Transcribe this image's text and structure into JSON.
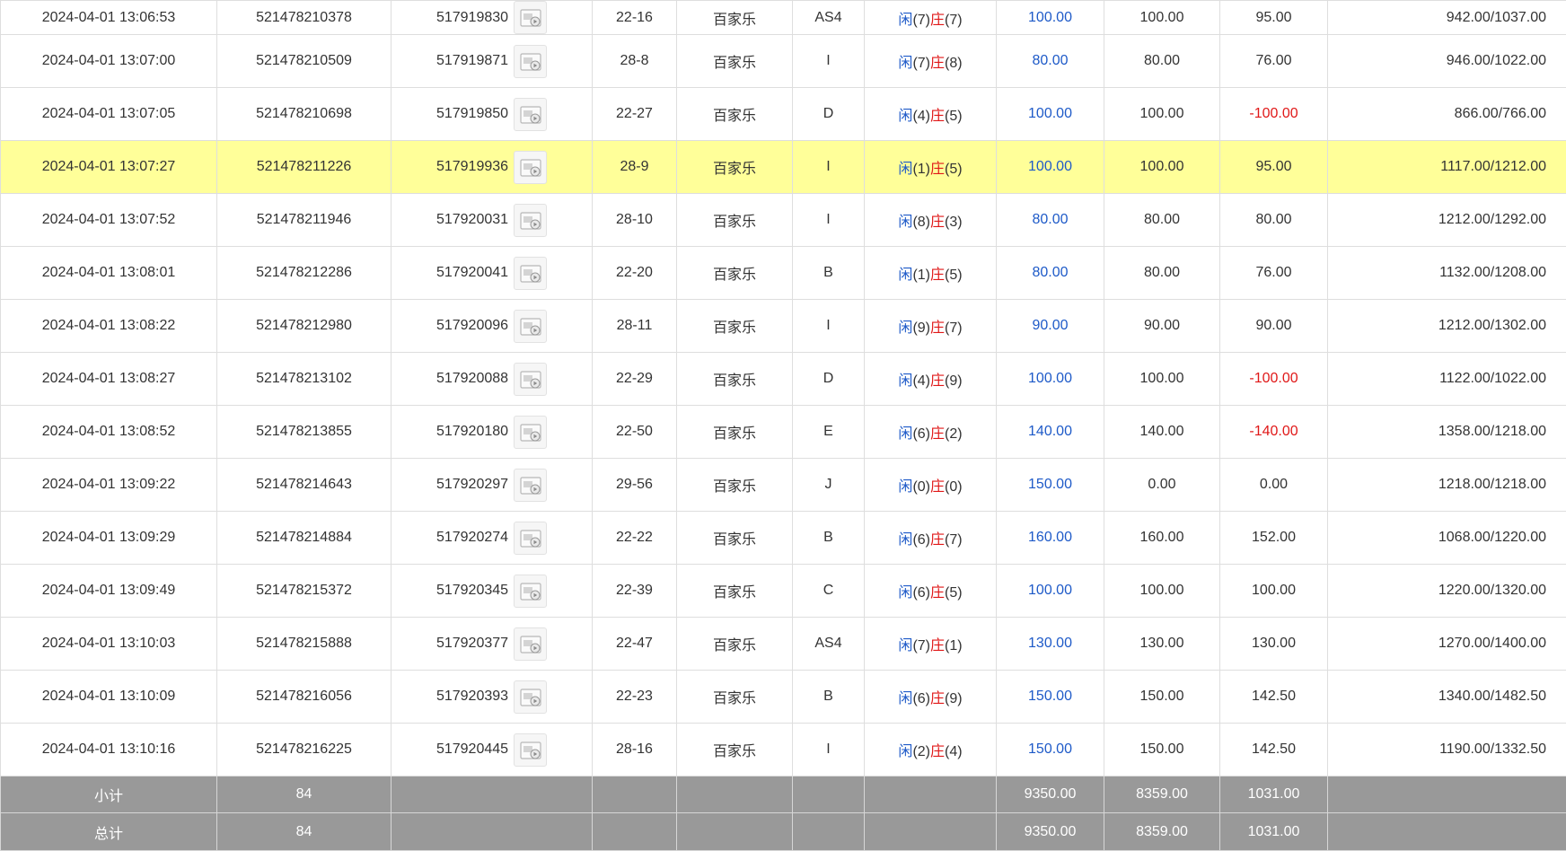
{
  "table": {
    "top_partial": {
      "bet_time": "2024-04-01 13:06:53",
      "bet_no": "521478210378",
      "game_no": "517919830",
      "table": "22-16",
      "game_type": "百家乐",
      "seat": "AS4",
      "player_score": "7",
      "banker_score": "7",
      "bet_amount": "100.00",
      "valid_bet": "100.00",
      "win_loss": "95.00",
      "balance": "942.00/1037.00"
    },
    "labels": {
      "player": "闲",
      "banker": "庄"
    },
    "rows": [
      {
        "bet_time": "2024-04-01 13:07:00",
        "bet_no": "521478210509",
        "game_no": "517919871",
        "table": "28-8",
        "game_type": "百家乐",
        "seat": "I",
        "player_score": "7",
        "banker_score": "8",
        "bet_amount": "80.00",
        "valid_bet": "80.00",
        "win_loss": "76.00",
        "balance": "946.00/1022.00"
      },
      {
        "bet_time": "2024-04-01 13:07:05",
        "bet_no": "521478210698",
        "game_no": "517919850",
        "table": "22-27",
        "game_type": "百家乐",
        "seat": "D",
        "player_score": "4",
        "banker_score": "5",
        "bet_amount": "100.00",
        "valid_bet": "100.00",
        "win_loss": "-100.00",
        "balance": "866.00/766.00"
      },
      {
        "bet_time": "2024-04-01 13:07:27",
        "bet_no": "521478211226",
        "game_no": "517919936",
        "table": "28-9",
        "game_type": "百家乐",
        "seat": "I",
        "player_score": "1",
        "banker_score": "5",
        "bet_amount": "100.00",
        "valid_bet": "100.00",
        "win_loss": "95.00",
        "balance": "1117.00/1212.00"
      },
      {
        "bet_time": "2024-04-01 13:07:52",
        "bet_no": "521478211946",
        "game_no": "517920031",
        "table": "28-10",
        "game_type": "百家乐",
        "seat": "I",
        "player_score": "8",
        "banker_score": "3",
        "bet_amount": "80.00",
        "valid_bet": "80.00",
        "win_loss": "80.00",
        "balance": "1212.00/1292.00"
      },
      {
        "bet_time": "2024-04-01 13:08:01",
        "bet_no": "521478212286",
        "game_no": "517920041",
        "table": "22-20",
        "game_type": "百家乐",
        "seat": "B",
        "player_score": "1",
        "banker_score": "5",
        "bet_amount": "80.00",
        "valid_bet": "80.00",
        "win_loss": "76.00",
        "balance": "1132.00/1208.00"
      },
      {
        "bet_time": "2024-04-01 13:08:22",
        "bet_no": "521478212980",
        "game_no": "517920096",
        "table": "28-11",
        "game_type": "百家乐",
        "seat": "I",
        "player_score": "9",
        "banker_score": "7",
        "bet_amount": "90.00",
        "valid_bet": "90.00",
        "win_loss": "90.00",
        "balance": "1212.00/1302.00"
      },
      {
        "bet_time": "2024-04-01 13:08:27",
        "bet_no": "521478213102",
        "game_no": "517920088",
        "table": "22-29",
        "game_type": "百家乐",
        "seat": "D",
        "player_score": "4",
        "banker_score": "9",
        "bet_amount": "100.00",
        "valid_bet": "100.00",
        "win_loss": "-100.00",
        "balance": "1122.00/1022.00"
      },
      {
        "bet_time": "2024-04-01 13:08:52",
        "bet_no": "521478213855",
        "game_no": "517920180",
        "table": "22-50",
        "game_type": "百家乐",
        "seat": "E",
        "player_score": "6",
        "banker_score": "2",
        "bet_amount": "140.00",
        "valid_bet": "140.00",
        "win_loss": "-140.00",
        "balance": "1358.00/1218.00"
      },
      {
        "bet_time": "2024-04-01 13:09:22",
        "bet_no": "521478214643",
        "game_no": "517920297",
        "table": "29-56",
        "game_type": "百家乐",
        "seat": "J",
        "player_score": "0",
        "banker_score": "0",
        "bet_amount": "150.00",
        "valid_bet": "0.00",
        "win_loss": "0.00",
        "balance": "1218.00/1218.00"
      },
      {
        "bet_time": "2024-04-01 13:09:29",
        "bet_no": "521478214884",
        "game_no": "517920274",
        "table": "22-22",
        "game_type": "百家乐",
        "seat": "B",
        "player_score": "6",
        "banker_score": "7",
        "bet_amount": "160.00",
        "valid_bet": "160.00",
        "win_loss": "152.00",
        "balance": "1068.00/1220.00"
      },
      {
        "bet_time": "2024-04-01 13:09:49",
        "bet_no": "521478215372",
        "game_no": "517920345",
        "table": "22-39",
        "game_type": "百家乐",
        "seat": "C",
        "player_score": "6",
        "banker_score": "5",
        "bet_amount": "100.00",
        "valid_bet": "100.00",
        "win_loss": "100.00",
        "balance": "1220.00/1320.00"
      },
      {
        "bet_time": "2024-04-01 13:10:03",
        "bet_no": "521478215888",
        "game_no": "517920377",
        "table": "22-47",
        "game_type": "百家乐",
        "seat": "AS4",
        "player_score": "7",
        "banker_score": "1",
        "bet_amount": "130.00",
        "valid_bet": "130.00",
        "win_loss": "130.00",
        "balance": "1270.00/1400.00"
      },
      {
        "bet_time": "2024-04-01 13:10:09",
        "bet_no": "521478216056",
        "game_no": "517920393",
        "table": "22-23",
        "game_type": "百家乐",
        "seat": "B",
        "player_score": "6",
        "banker_score": "9",
        "bet_amount": "150.00",
        "valid_bet": "150.00",
        "win_loss": "142.50",
        "balance": "1340.00/1482.50"
      },
      {
        "bet_time": "2024-04-01 13:10:16",
        "bet_no": "521478216225",
        "game_no": "517920445",
        "table": "28-16",
        "game_type": "百家乐",
        "seat": "I",
        "player_score": "2",
        "banker_score": "4",
        "bet_amount": "150.00",
        "valid_bet": "150.00",
        "win_loss": "142.50",
        "balance": "1190.00/1332.50"
      }
    ],
    "highlighted_row_index": 2,
    "subtotal": {
      "label": "小计",
      "count": "84",
      "bet_amount": "9350.00",
      "valid_bet": "8359.00",
      "win_loss": "1031.00"
    },
    "total": {
      "label": "总计",
      "count": "84",
      "bet_amount": "9350.00",
      "valid_bet": "8359.00",
      "win_loss": "1031.00"
    }
  },
  "icons": {
    "replay": "video-replay-icon"
  },
  "colors": {
    "highlight": "#ffff99",
    "player": "#1e5ac8",
    "banker": "#e01818",
    "summary_bg": "#999999"
  }
}
